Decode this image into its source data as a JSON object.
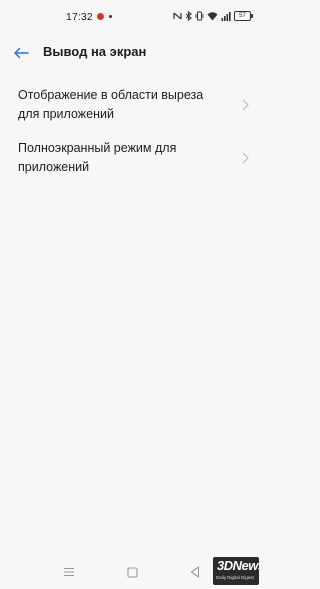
{
  "status_bar": {
    "time": "17:32",
    "battery": "57",
    "icons": [
      "nfc-icon",
      "bluetooth-icon",
      "vibrate-icon",
      "wifi-icon",
      "signal-icon",
      "battery-icon"
    ]
  },
  "header": {
    "title": "Вывод на экран",
    "back_icon": "back-arrow-icon"
  },
  "settings": {
    "items": [
      {
        "label": "Отображение в области выреза для приложений"
      },
      {
        "label": "Полноэкранный режим для приложений"
      }
    ]
  },
  "navigation": {
    "buttons": [
      "menu-icon",
      "home-icon",
      "back-icon"
    ]
  },
  "watermark": {
    "brand": "3DNews",
    "tagline": "Daily Digital Digest"
  },
  "colors": {
    "background": "#f7f7f8",
    "accent": "#2f6fe4",
    "text": "#1d1d1d",
    "chevron": "#c4c4c4"
  }
}
